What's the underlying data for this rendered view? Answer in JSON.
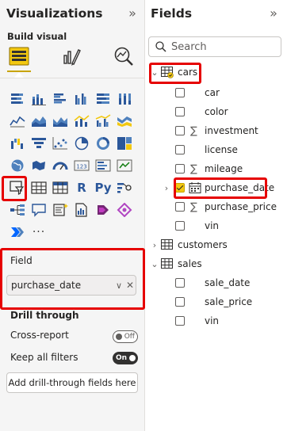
{
  "visualizations": {
    "title": "Visualizations",
    "collapse_icon": "»",
    "build_label": "Build visual",
    "field_section": {
      "label": "Field",
      "value": "purchase_date",
      "chevron": "∨",
      "remove": "✕"
    },
    "drill_through": {
      "title": "Drill through",
      "cross_report_label": "Cross-report",
      "cross_report_toggle": "Off",
      "keep_filters_label": "Keep all filters",
      "keep_filters_toggle": "On",
      "drop_label": "Add drill-through fields here"
    },
    "custom_visual_labels": {
      "r": "R",
      "py": "Py",
      "more": "···"
    },
    "accent_color": "#F2C811",
    "highlight_color": "#E60000"
  },
  "fields": {
    "title": "Fields",
    "collapse_icon": "»",
    "search_placeholder": "Search",
    "tables": [
      {
        "name": "cars",
        "expanded": true,
        "items": [
          {
            "name": "car",
            "type": "text"
          },
          {
            "name": "color",
            "type": "text"
          },
          {
            "name": "investment",
            "type": "sum"
          },
          {
            "name": "license",
            "type": "text"
          },
          {
            "name": "mileage",
            "type": "sum"
          },
          {
            "name": "purchase_date",
            "type": "date",
            "checked": true
          },
          {
            "name": "purchase_price",
            "type": "sum"
          },
          {
            "name": "vin",
            "type": "text"
          }
        ]
      },
      {
        "name": "customers",
        "expanded": false,
        "items": []
      },
      {
        "name": "sales",
        "expanded": true,
        "items": [
          {
            "name": "sale_date",
            "type": "text"
          },
          {
            "name": "sale_price",
            "type": "text"
          },
          {
            "name": "vin",
            "type": "text"
          }
        ]
      }
    ],
    "sigma_glyph": "∑"
  }
}
